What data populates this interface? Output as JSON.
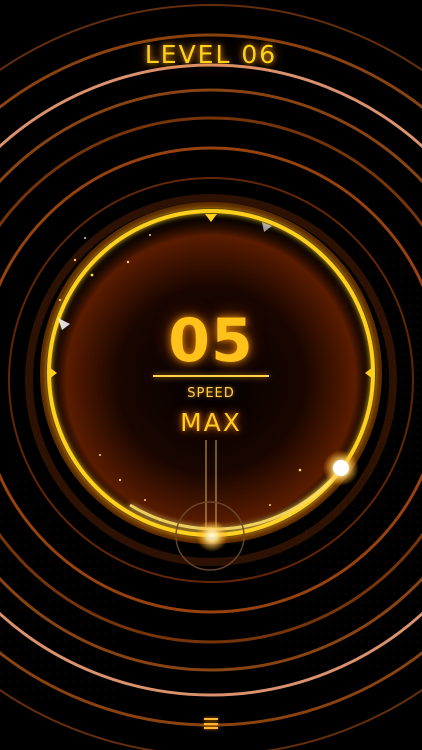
{
  "header": {
    "level_title": "LEVEL 06"
  },
  "dial": {
    "counter": "05",
    "speed_label": "SPEED",
    "speed_value": "MAX"
  },
  "footer": {
    "menu_icon": "hamburger-menu-icon"
  },
  "colors": {
    "accent": "#ffc21a",
    "ring_glow": "#ff8a00",
    "background": "#000000"
  }
}
